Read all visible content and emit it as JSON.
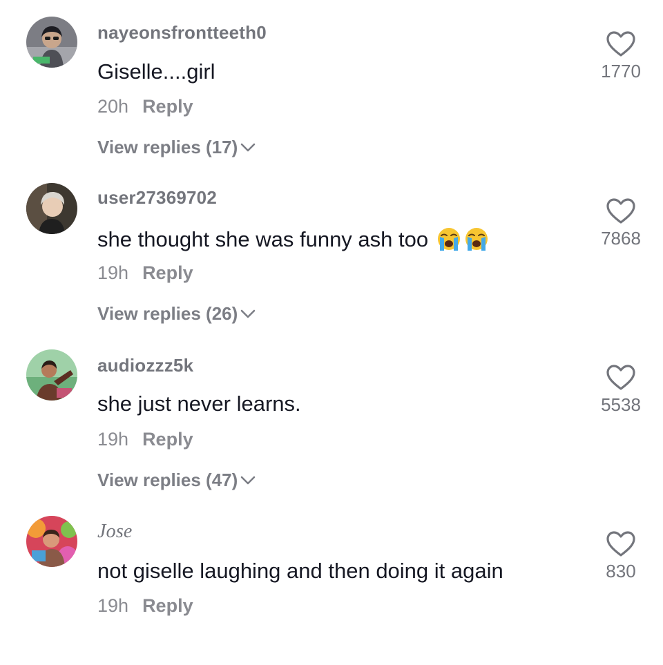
{
  "comments": [
    {
      "username": "nayeonsfrontteeth0",
      "text": "Giselle....girl",
      "time": "20h",
      "reply_label": "Reply",
      "view_replies": "View replies (17)",
      "likes": "1770",
      "avatar_icon": "profile-photo"
    },
    {
      "username": "user27369702",
      "text": "she thought she was funny ash too",
      "emoji": "loudly-crying-face x2",
      "time": "19h",
      "reply_label": "Reply",
      "view_replies": "View replies (26)",
      "likes": "7868",
      "avatar_icon": "profile-photo"
    },
    {
      "username": "audiozzz5k",
      "text": "she just never learns.",
      "time": "19h",
      "reply_label": "Reply",
      "view_replies": "View replies (47)",
      "likes": "5538",
      "avatar_icon": "profile-photo"
    },
    {
      "username": "Jose",
      "text": "not giselle laughing and then doing it again",
      "time": "19h",
      "reply_label": "Reply",
      "likes": "830",
      "avatar_icon": "profile-photo"
    }
  ],
  "colors": {
    "text": "#161823",
    "secondary": "#73757c",
    "emoji_yellow": "#f7c531"
  }
}
